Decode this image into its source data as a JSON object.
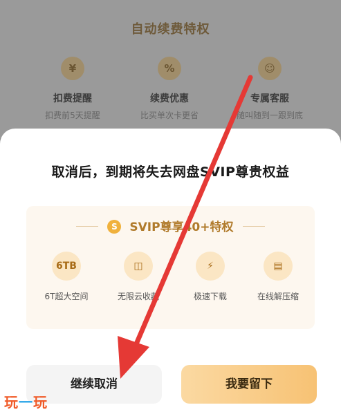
{
  "background": {
    "title": "自动续费特权",
    "features": [
      {
        "icon": "yen-icon",
        "glyph": "¥",
        "title": "扣费提醒",
        "subtitle": "扣费前5天提醒"
      },
      {
        "icon": "discount-icon",
        "glyph": "%",
        "title": "续费优惠",
        "subtitle": "比买单次卡更省"
      },
      {
        "icon": "customer-service-icon",
        "glyph": "☺",
        "title": "专属客服",
        "subtitle": "随叫随到一跟到底"
      }
    ]
  },
  "dialog": {
    "title": "取消后，到期将失去网盘SVIP尊贵权益",
    "badge_coin": "S",
    "badge_text": "SVIP尊享40+特权",
    "benefits": [
      {
        "icon": "storage-6tb-icon",
        "glyph": "6TB",
        "label": "6T超大空间"
      },
      {
        "icon": "cloud-collect-icon",
        "glyph": "◫",
        "label": "无限云收藏"
      },
      {
        "icon": "lightning-icon",
        "glyph": "⚡",
        "label": "极速下载"
      },
      {
        "icon": "zip-icon",
        "glyph": "▤",
        "label": "在线解压缩"
      }
    ],
    "cancel_label": "继续取消",
    "stay_label": "我要留下"
  },
  "watermark": {
    "part1": "玩",
    "part2": "一",
    "part3": "玩"
  },
  "colors": {
    "accent": "#f7c274",
    "arrow": "#e53935",
    "badge": "#b07a2a"
  }
}
